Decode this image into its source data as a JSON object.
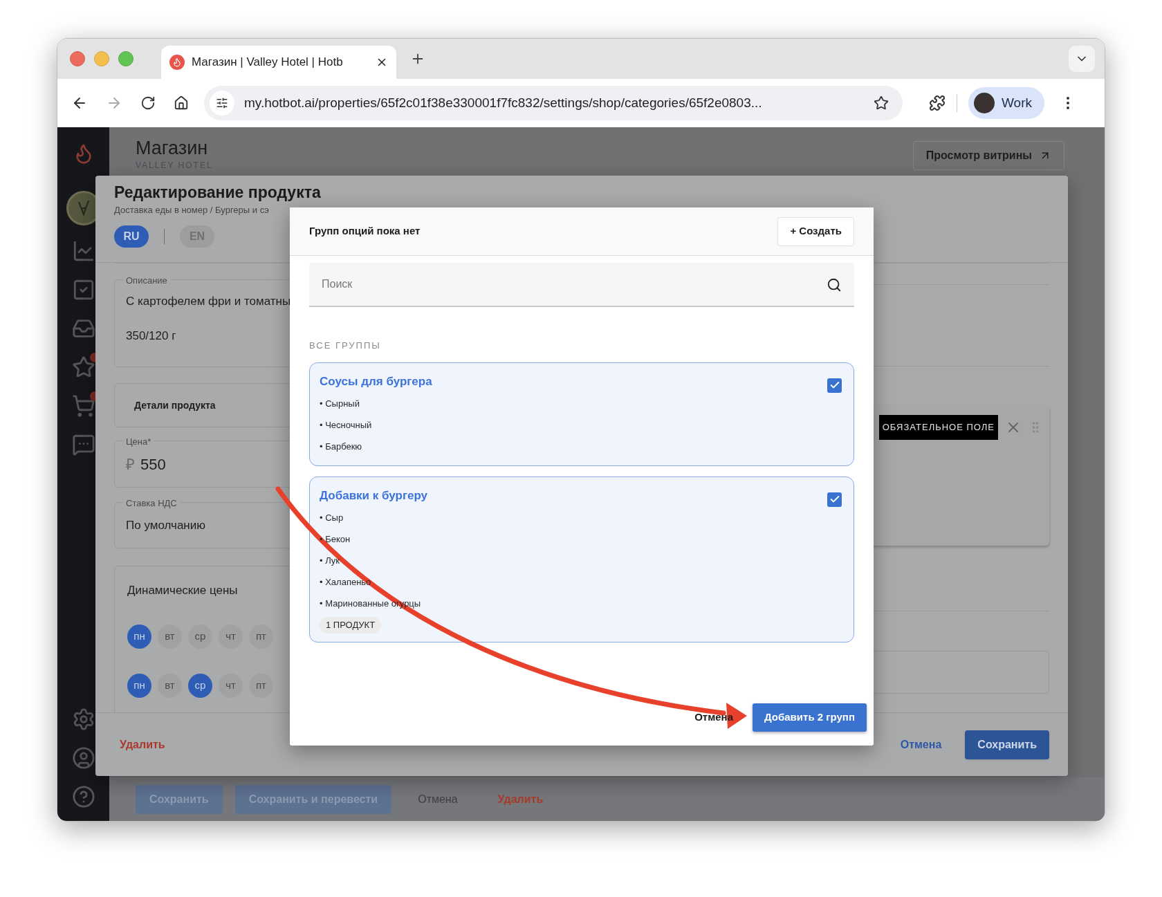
{
  "browser": {
    "tab_title": "Магазин | Valley Hotel | Hotb",
    "url": "my.hotbot.ai/properties/65f2c01f38e330001f7fc832/settings/shop/categories/65f2e0803...",
    "profile": "Work"
  },
  "page": {
    "title": "Магазин",
    "subtitle": "VALLEY HOTEL",
    "storefront_button": "Просмотр витрины"
  },
  "bottom_bar": {
    "buttons": [
      {
        "label": "Сохранить",
        "kind": "primary"
      },
      {
        "label": "Сохранить и перевести",
        "kind": "primary"
      },
      {
        "label": "Отмена",
        "kind": "text"
      },
      {
        "label": "Удалить",
        "kind": "danger"
      }
    ]
  },
  "product_dialog": {
    "title": "Редактирование продукта",
    "breadcrumb": "Доставка еды в номер / Бургеры и сэ",
    "languages": [
      {
        "label": "RU",
        "selected": true
      },
      {
        "label": "EN",
        "selected": false
      }
    ],
    "description": {
      "label": "Описание",
      "lines": [
        "С картофелем фри и томатны",
        "350/120 г"
      ]
    },
    "details": "Детали продукта",
    "price": {
      "label": "Цена*",
      "currency": "₽",
      "value": "550"
    },
    "vat": {
      "label": "Ставка НДС",
      "value": "По умолчанию"
    },
    "dynamic_prices": {
      "title": "Динамические цены",
      "rows": [
        [
          {
            "label": "пн",
            "selected": true
          },
          {
            "label": "вт",
            "selected": false
          },
          {
            "label": "ср",
            "selected": false
          },
          {
            "label": "чт",
            "selected": false
          },
          {
            "label": "пт",
            "selected": false
          }
        ],
        [
          {
            "label": "пн",
            "selected": true
          },
          {
            "label": "вт",
            "selected": false
          },
          {
            "label": "ср",
            "selected": true
          },
          {
            "label": "чт",
            "selected": false
          },
          {
            "label": "пт",
            "selected": false
          }
        ]
      ]
    },
    "required_badge": "ОБЯЗАТЕЛЬНОЕ ПОЛЕ",
    "delete": "Удалить",
    "cancel": "Отмена",
    "save": "Сохранить"
  },
  "options_modal": {
    "title": "Групп опций пока нет",
    "create_button": "+ Создать",
    "search": {
      "placeholder": "Поиск"
    },
    "section": "ВСЕ ГРУППЫ",
    "groups": [
      {
        "name": "Соусы для бургера",
        "checked": true,
        "options": [
          "• Сырный",
          "• Чесночный",
          "• Барбекю"
        ]
      },
      {
        "name": "Добавки к бургеру",
        "checked": true,
        "options": [
          "• Сыр",
          "• Бекон",
          "• Лук",
          "• Халапеньо",
          "• Маринованные огурцы"
        ],
        "badge": "1 ПРОДУКТ"
      }
    ],
    "cancel": "Отмена",
    "submit": "Добавить 2 групп"
  }
}
